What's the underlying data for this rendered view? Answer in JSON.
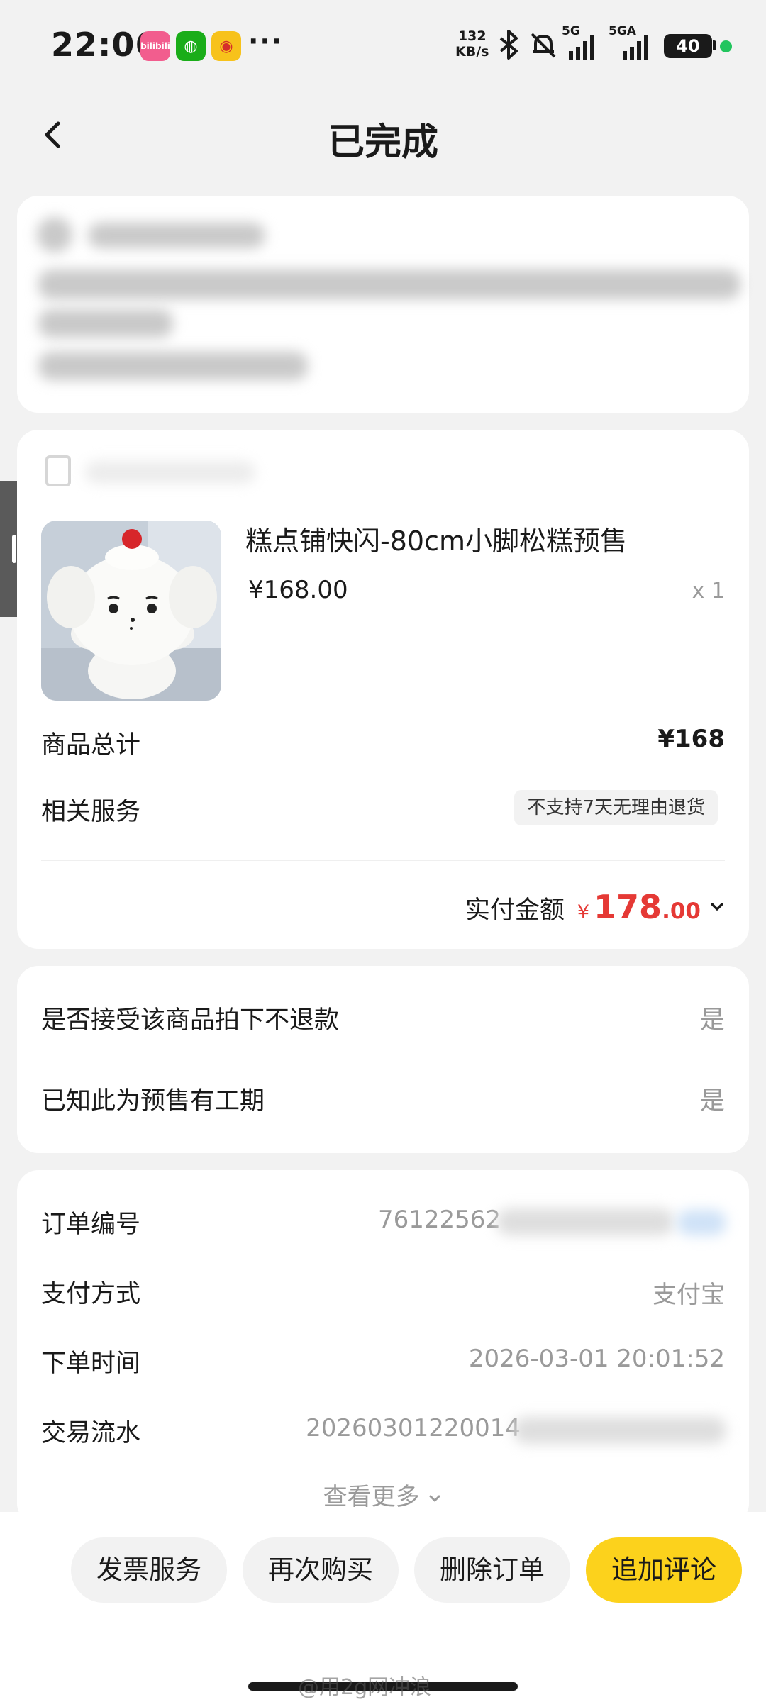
{
  "status_bar": {
    "time": "22:06",
    "network_speed_value": "132",
    "network_speed_unit": "KB/s",
    "signal1_label": "5G",
    "signal2_label": "5GA",
    "battery": "40",
    "app_icons": [
      "bilibili-icon",
      "wechat-icon",
      "weibo-icon"
    ],
    "bili_text": "bilibili"
  },
  "header": {
    "title": "已完成"
  },
  "product": {
    "name": "糕点铺快闪-80cm小脚松糕预售",
    "unit_price": "¥168.00",
    "quantity": "x 1",
    "total_label": "商品总计",
    "total_value": "¥168",
    "service_label": "相关服务",
    "service_tag": "不支持7天无理由退货",
    "paid_label": "实付金额",
    "paid_currency": "¥",
    "paid_integer": "178",
    "paid_decimal": ".00"
  },
  "questions": [
    {
      "label": "是否接受该商品拍下不退款",
      "answer": "是"
    },
    {
      "label": "已知此为预售有工期",
      "answer": "是"
    }
  ],
  "order_info": {
    "order_no_label": "订单编号",
    "order_no_value": "76122562",
    "payment_label": "支付方式",
    "payment_value": "支付宝",
    "time_label": "下单时间",
    "time_value": "2026-03-01 20:01:52",
    "txn_label": "交易流水",
    "txn_value": "20260301220014",
    "see_more": "查看更多"
  },
  "actions": {
    "invoice": "发票服务",
    "buy_again": "再次购买",
    "delete": "删除订单",
    "add_review": "追加评论"
  },
  "watermark": "@用2g网冲浪",
  "colors": {
    "accent_yellow": "#fcd21c",
    "price_red": "#e53935",
    "page_bg": "#f2f2f2"
  }
}
